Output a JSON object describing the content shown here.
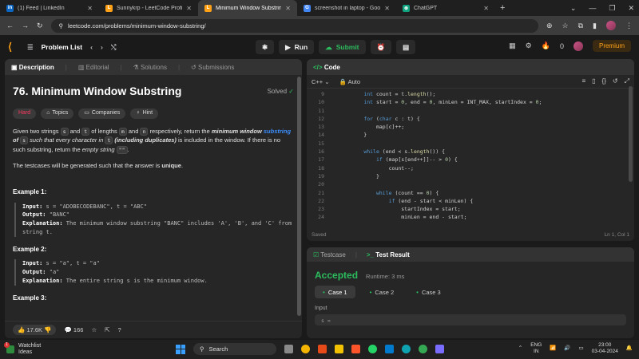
{
  "browser": {
    "tabs": [
      {
        "title": "(1) Feed | LinkedIn",
        "fav_text": "in",
        "color": "#0a66c2"
      },
      {
        "title": "Sunnykrp - LeetCode Profile",
        "fav_text": "L",
        "color": "#ffa116"
      },
      {
        "title": "Minimum Window Substring - ",
        "fav_text": "L",
        "color": "#ffa116"
      },
      {
        "title": "screenshot in laptop - Google S",
        "fav_text": "G",
        "color": "#4285f4"
      },
      {
        "title": "ChatGPT",
        "fav_text": "⊛",
        "color": "#10a37f"
      }
    ],
    "url": "leetcode.com/problems/minimum-window-substring/"
  },
  "nav": {
    "problem_list": "Problem List",
    "run": "Run",
    "submit": "Submit",
    "streak": "0",
    "premium": "Premium"
  },
  "left": {
    "tabs": [
      "Description",
      "Editorial",
      "Solutions",
      "Submissions"
    ],
    "title": "76. Minimum Window Substring",
    "solved": "Solved",
    "tags": [
      "Hard",
      "Topics",
      "Companies",
      "Hint"
    ],
    "desc_parts": {
      "p1a": "Given two strings ",
      "s": "s",
      "p1b": " and ",
      "t": "t",
      "p1c": " of lengths ",
      "m": "m",
      "p1d": " and ",
      "n": "n",
      "p1e": " respectively, return the ",
      "p1f": "minimum window",
      "p1g": "substring",
      "p1h": " of ",
      "p1i": " such that every character in ",
      "p1j": "(including duplicates)",
      "p1k": " is included in the window. If there is no such substring, return the ",
      "p1l": "empty string",
      "empty": "\"\"",
      "p1m": "."
    },
    "p2a": "The testcases will be generated such that the answer is ",
    "p2b": "unique",
    "p2c": ".",
    "examples": [
      {
        "h": "Example 1:",
        "input": "s = \"ADOBECODEBANC\", t = \"ABC\"",
        "output": "\"BANC\"",
        "explanation": "The minimum window substring \"BANC\" includes 'A', 'B', and 'C' from string t."
      },
      {
        "h": "Example 2:",
        "input": "s = \"a\", t = \"a\"",
        "output": "\"a\"",
        "explanation": "The entire string s is the minimum window."
      },
      {
        "h": "Example 3:"
      }
    ],
    "labels": {
      "input": "Input:",
      "output": "Output:",
      "explanation": "Explanation:"
    },
    "likes": "17.6K",
    "comments": "166"
  },
  "code": {
    "title": "Code",
    "lang": "C++",
    "auto": "Auto",
    "status_left": "Saved",
    "status_right": "Ln 1, Col 1",
    "lines": [
      {
        "n": "9",
        "t": "        int count = t.length();"
      },
      {
        "n": "10",
        "t": "        int start = 0, end = 0, minLen = INT_MAX, startIndex = 0;"
      },
      {
        "n": "11",
        "t": ""
      },
      {
        "n": "12",
        "t": "        for (char c : t) {"
      },
      {
        "n": "13",
        "t": "            map[c]++;"
      },
      {
        "n": "14",
        "t": "        }"
      },
      {
        "n": "15",
        "t": ""
      },
      {
        "n": "16",
        "t": "        while (end < s.length()) {"
      },
      {
        "n": "17",
        "t": "            if (map[s[end++]]-- > 0) {"
      },
      {
        "n": "18",
        "t": "                count--;"
      },
      {
        "n": "19",
        "t": "            }"
      },
      {
        "n": "20",
        "t": ""
      },
      {
        "n": "21",
        "t": "            while (count == 0) {"
      },
      {
        "n": "22",
        "t": "                if (end - start < minLen) {"
      },
      {
        "n": "23",
        "t": "                    startIndex = start;"
      },
      {
        "n": "24",
        "t": "                    minLen = end - start;"
      }
    ]
  },
  "test": {
    "tab1": "Testcase",
    "tab2": "Test Result",
    "accepted": "Accepted",
    "runtime": "Runtime: 3 ms",
    "cases": [
      "Case 1",
      "Case 2",
      "Case 3"
    ],
    "input_label": "Input",
    "input_val": "s ="
  },
  "taskbar": {
    "weather1": "Watchlist",
    "weather2": "Ideas",
    "badge": "1",
    "search": "Search",
    "lang1": "ENG",
    "lang2": "IN",
    "time": "23:00",
    "date": "03-04-2024"
  }
}
